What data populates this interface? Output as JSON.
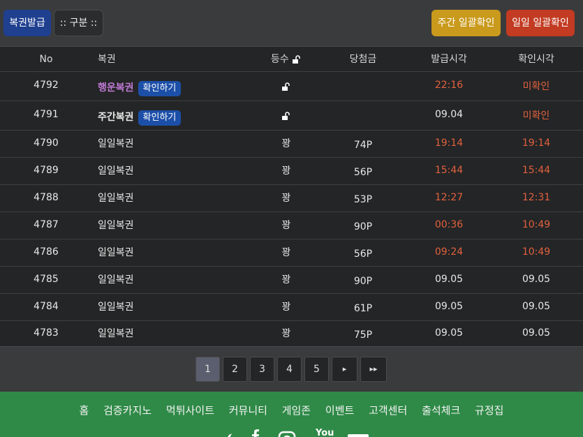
{
  "toolbar": {
    "issue_label": "복권발급",
    "category_label": ":: 구분 ::",
    "weekly_confirm_label": "주간 일괄확인",
    "daily_confirm_label": "일일 일괄확인"
  },
  "table": {
    "headers": {
      "no": "No",
      "name": "복권",
      "grade": "등수",
      "prize": "당첨금",
      "issued": "발급시각",
      "confirmed": "확인시각"
    },
    "confirm_badge": "확인하기",
    "rows": [
      {
        "no": "4792",
        "name": "행운복권",
        "grade": "",
        "prize": "",
        "issued": "22:16",
        "confirmed": "미확인"
      },
      {
        "no": "4791",
        "name": "주간복권",
        "grade": "",
        "prize": "",
        "issued": "09.04",
        "confirmed": "미확인"
      },
      {
        "no": "4790",
        "name": "일일복권",
        "grade": "꽝",
        "prize": "74P",
        "issued": "19:14",
        "confirmed": "19:14"
      },
      {
        "no": "4789",
        "name": "일일복권",
        "grade": "꽝",
        "prize": "56P",
        "issued": "15:44",
        "confirmed": "15:44"
      },
      {
        "no": "4788",
        "name": "일일복권",
        "grade": "꽝",
        "prize": "53P",
        "issued": "12:27",
        "confirmed": "12:31"
      },
      {
        "no": "4787",
        "name": "일일복권",
        "grade": "꽝",
        "prize": "90P",
        "issued": "00:36",
        "confirmed": "10:49"
      },
      {
        "no": "4786",
        "name": "일일복권",
        "grade": "꽝",
        "prize": "56P",
        "issued": "09:24",
        "confirmed": "10:49"
      },
      {
        "no": "4785",
        "name": "일일복권",
        "grade": "꽝",
        "prize": "90P",
        "issued": "09.05",
        "confirmed": "09.05"
      },
      {
        "no": "4784",
        "name": "일일복권",
        "grade": "꽝",
        "prize": "61P",
        "issued": "09.05",
        "confirmed": "09.05"
      },
      {
        "no": "4783",
        "name": "일일복권",
        "grade": "꽝",
        "prize": "75P",
        "issued": "09.05",
        "confirmed": "09.05"
      }
    ]
  },
  "pagination": {
    "pages": [
      "1",
      "2",
      "3",
      "4",
      "5"
    ],
    "current": "1",
    "next": "▸",
    "last": "▸▸"
  },
  "footer": {
    "nav": [
      "홈",
      "검증카지노",
      "먹튀사이트",
      "커뮤니티",
      "게임존",
      "이벤트",
      "고객센터",
      "출석체크",
      "규정집"
    ],
    "social_youtube": "You"
  },
  "colors": {
    "accent_red": "#e2613f",
    "purple_name": "#c07ad6",
    "badge_blue": "#1c4fa8",
    "footer_green": "#2f8a47"
  }
}
